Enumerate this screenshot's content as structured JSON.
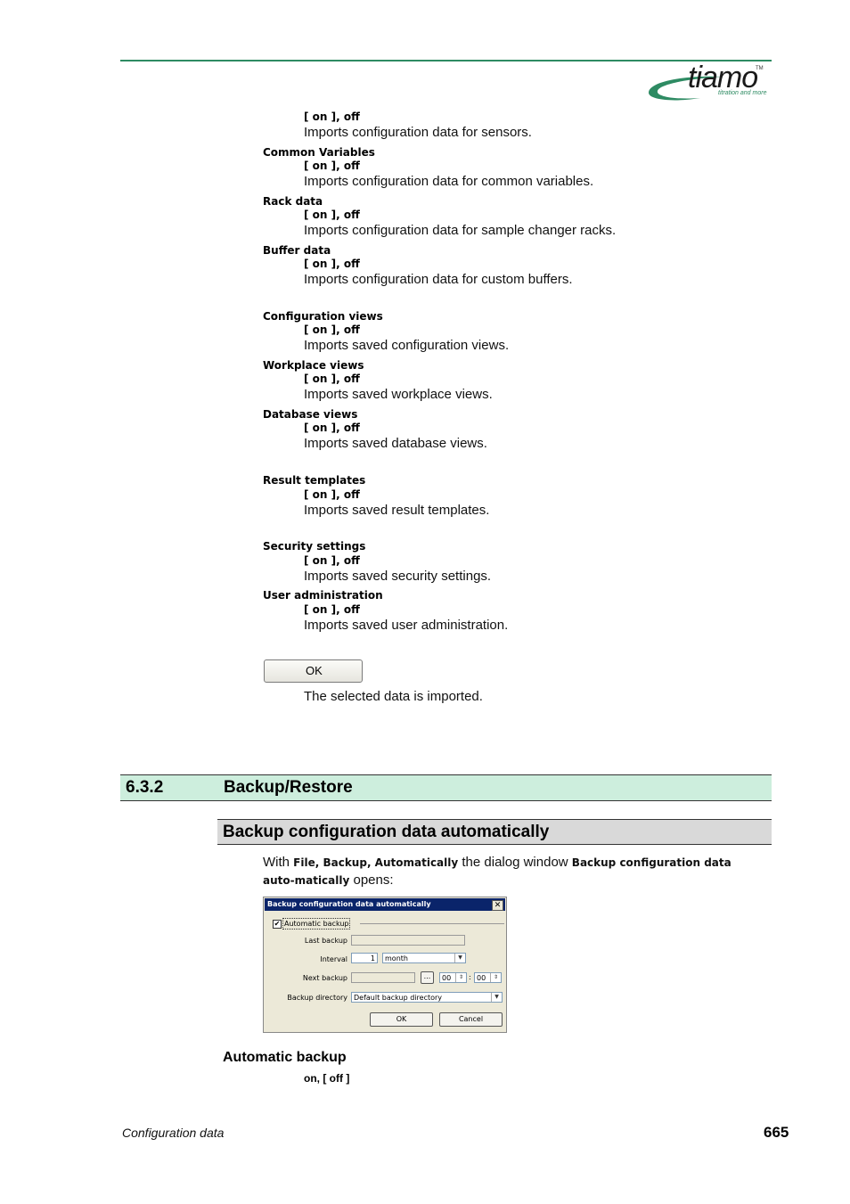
{
  "header": {
    "logo_text": "tiamo",
    "logo_tm": "TM",
    "logo_tagline": "titration and more",
    "brand_color": "#2e8b63"
  },
  "params": [
    {
      "name": "",
      "values": "[ on ], off",
      "desc": "Imports configuration data for sensors."
    },
    {
      "name": "Common Variables",
      "values": "[ on ], off",
      "desc": "Imports configuration data for common variables."
    },
    {
      "name": "Rack data",
      "values": "[ on ], off",
      "desc": "Imports configuration data for sample changer racks."
    },
    {
      "name": "Buffer data",
      "values": "[ on ], off",
      "desc": "Imports configuration data for custom buffers."
    },
    {
      "name": "Configuration views",
      "values": "[ on ], off",
      "desc": "Imports saved configuration views."
    },
    {
      "name": "Workplace views",
      "values": "[ on ], off",
      "desc": "Imports saved workplace views."
    },
    {
      "name": "Database views",
      "values": "[ on ], off",
      "desc": "Imports saved database views."
    },
    {
      "name": "Result templates",
      "values": "[ on ], off",
      "desc": "Imports saved result templates."
    },
    {
      "name": "Security settings",
      "values": "[ on ], off",
      "desc": "Imports saved security settings."
    },
    {
      "name": "User administration",
      "values": "[ on ], off",
      "desc": "Imports saved user administration."
    }
  ],
  "ok_button": {
    "label": "OK",
    "desc": "The selected data is imported."
  },
  "section": {
    "number": "6.3.2",
    "title": "Backup/Restore",
    "color": "#cdeedd"
  },
  "subsection": {
    "title": "Backup configuration data automatically"
  },
  "intro": {
    "t1": "With ",
    "b1": "File, Backup, Automatically",
    "t2": " the dialog window ",
    "b2": "Backup configuration data auto-matically",
    "t3": " opens:"
  },
  "dialog": {
    "title": "Backup configuration data automatically",
    "close": "✕",
    "checkbox_mark": "✔",
    "group_label": "Automatic backup",
    "last_backup_label": "Last backup",
    "last_backup_value": "",
    "interval_label": "Interval",
    "interval_value": "1",
    "interval_unit": "month",
    "next_backup_label": "Next backup",
    "next_backup_value": "",
    "browse_label": "...",
    "hour": "00",
    "minute": "00",
    "time_sep": ":",
    "dir_label": "Backup directory",
    "dir_value": "Default backup directory",
    "ok": "OK",
    "cancel": "Cancel",
    "titlebar_color": "#0a246a"
  },
  "automatic_backup": {
    "title": "Automatic backup",
    "values": "on, [ off ]"
  },
  "footer": {
    "chapter": "Configuration data",
    "page": "665"
  }
}
